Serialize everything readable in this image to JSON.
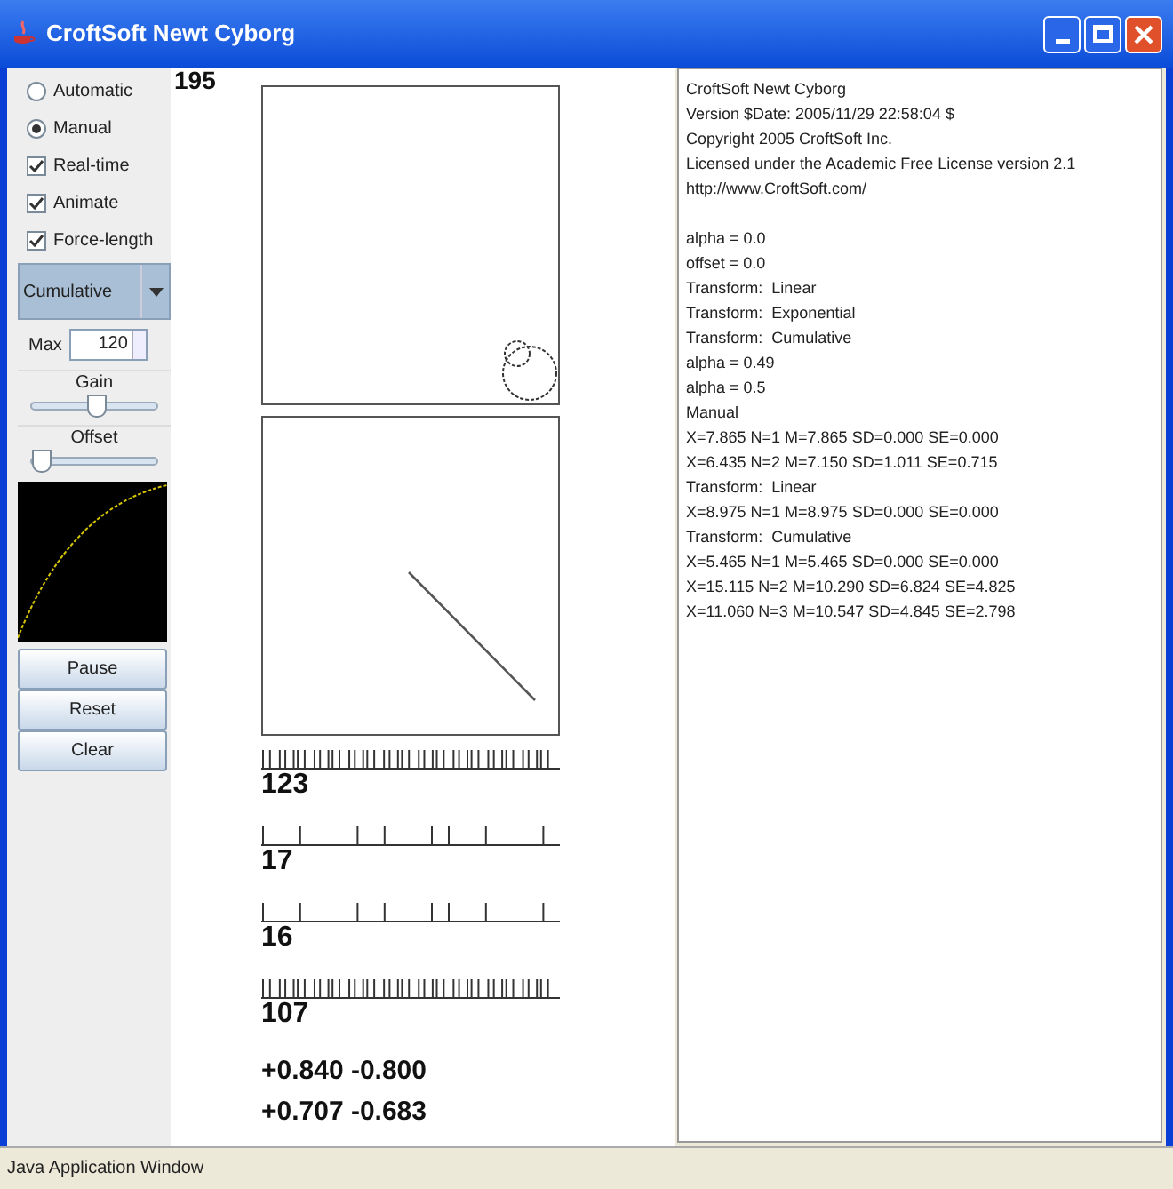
{
  "window": {
    "title": "CroftSoft Newt Cyborg"
  },
  "controls": [
    {
      "kind": "radio",
      "label": "Automatic",
      "checked": false
    },
    {
      "kind": "radio",
      "label": "Manual",
      "checked": true
    },
    {
      "kind": "checkbox",
      "label": "Real-time",
      "checked": true
    },
    {
      "kind": "checkbox",
      "label": "Animate",
      "checked": true
    },
    {
      "kind": "checkbox",
      "label": "Force-length",
      "checked": true
    }
  ],
  "transform_select": {
    "value": "Cumulative"
  },
  "max_spinner": {
    "label": "Max",
    "value": "120"
  },
  "sliders": [
    {
      "label": "Gain",
      "level": 0.5
    },
    {
      "label": "Offset",
      "level": 0.0
    }
  ],
  "buttons": [
    "Pause",
    "Reset",
    "Clear"
  ],
  "counter": "195",
  "spike_trains": [
    {
      "kind": "dense",
      "count": "123"
    },
    {
      "kind": "sparse",
      "count": "17"
    },
    {
      "kind": "sparse",
      "count": "16"
    },
    {
      "kind": "dense",
      "count": "107"
    }
  ],
  "readouts": [
    "+0.840 -0.800",
    "+0.707 -0.683"
  ],
  "about_lines": [
    "CroftSoft Newt Cyborg",
    "Version $Date: 2005/11/29 22:58:04 $",
    "Copyright 2005 CroftSoft Inc.",
    "Licensed under the Academic Free License version 2.1",
    "http://www.CroftSoft.com/"
  ],
  "log_lines": [
    "alpha = 0.0",
    "offset = 0.0",
    "Transform:  Linear",
    "Transform:  Exponential",
    "Transform:  Cumulative",
    "alpha = 0.49",
    "alpha = 0.5",
    "Manual",
    "X=7.865 N=1 M=7.865 SD=0.000 SE=0.000",
    "X=6.435 N=2 M=7.150 SD=1.011 SE=0.715",
    "Transform:  Linear",
    "X=8.975 N=1 M=8.975 SD=0.000 SE=0.000",
    "Transform:  Cumulative",
    "X=5.465 N=1 M=5.465 SD=0.000 SE=0.000",
    "X=15.115 N=2 M=10.290 SD=6.824 SE=4.825",
    "X=11.060 N=3 M=10.547 SD=4.845 SE=2.798"
  ],
  "status_bar": "Java Application Window"
}
